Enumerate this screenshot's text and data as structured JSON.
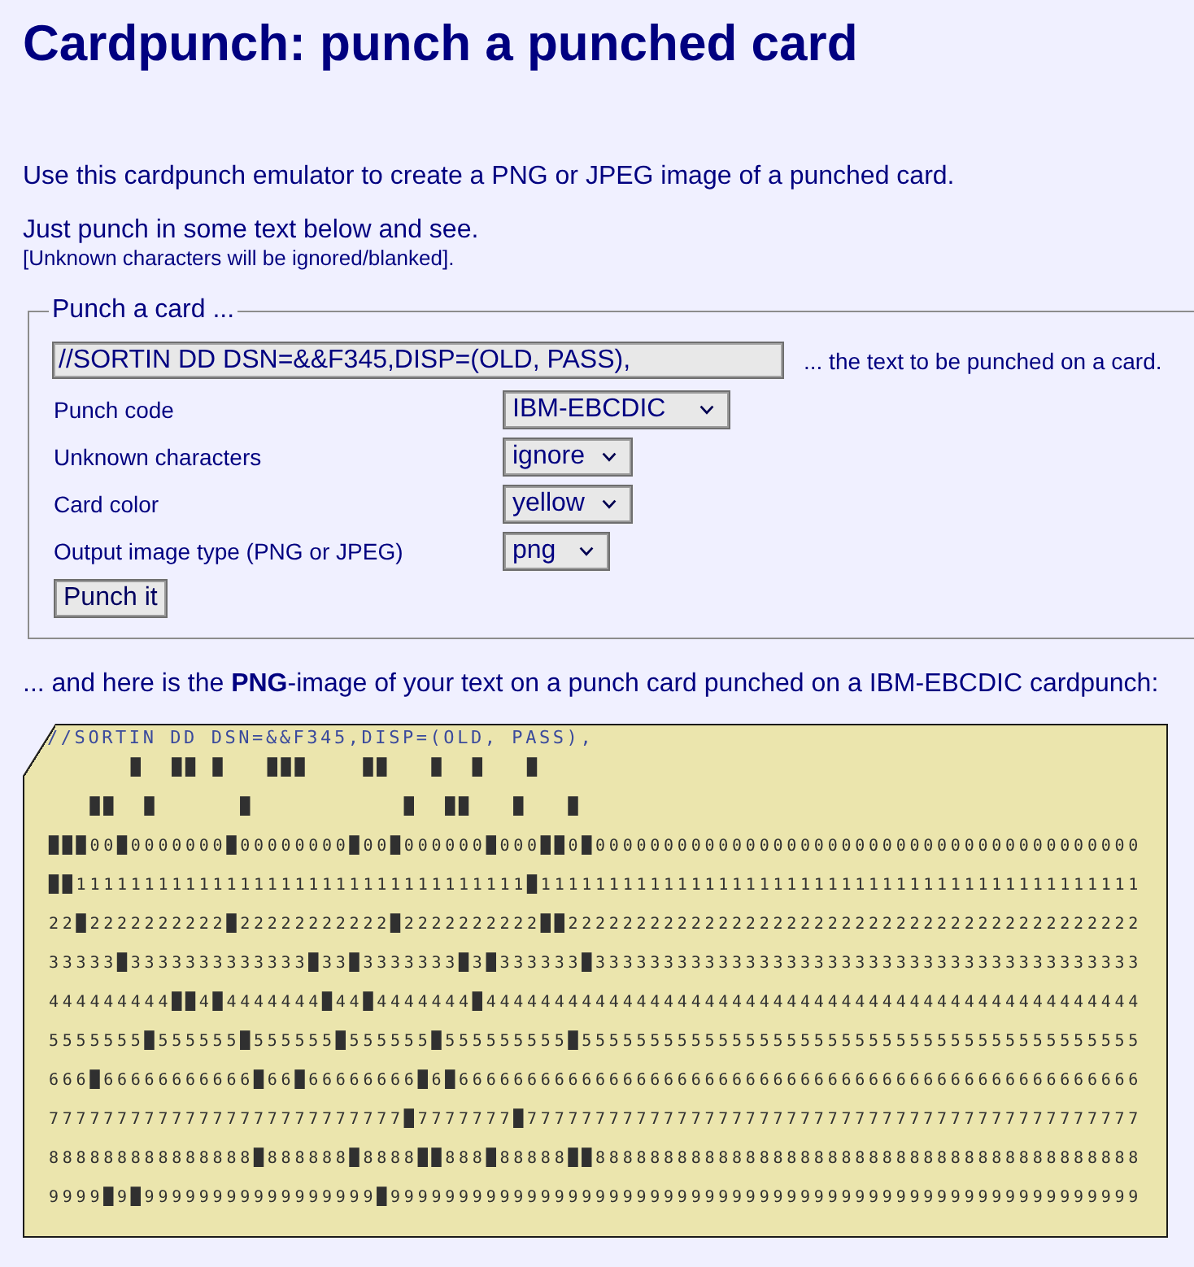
{
  "title": "Cardpunch: punch a punched card",
  "intro": [
    "Use this cardpunch emulator to create a PNG or JPEG image of a punched card.",
    "Just punch in some text below and see."
  ],
  "note": "[Unknown characters will be ignored/blanked].",
  "form": {
    "legend": "Punch a card ...",
    "text_field": {
      "value": "//SORTIN DD DSN=&&F345,DISP=(OLD, PASS),",
      "note": "... the text to be punched on a card."
    },
    "options": [
      {
        "label": "Punch code",
        "value": "IBM-EBCDIC"
      },
      {
        "label": "Unknown characters",
        "value": "ignore"
      },
      {
        "label": "Card color",
        "value": "yellow"
      },
      {
        "label": "Output image type (PNG or JPEG)",
        "value": "png"
      }
    ],
    "submit_button": "Punch it"
  },
  "result_caption": "... and here is the **PNG**-image of your text on a punch card punched on a IBM-EBCDIC cardpunch:",
  "card": {
    "printed_text": "//SORTIN DD DSN=&&F345,DISP=(OLD, PASS),",
    "rows": [
      "      █  ██ █   ███    ██   █  █   █",
      "   ██  █      █           █  ██   █   █",
      "███00█0000000█00000000█00█000000█000██0█0000000000000000000000000000000000000000",
      "██111111111111111111111111111111111█11111111111111111111111111111111111111111111",
      "22█2222222222█22222222222█2222222222██222222222222222222222222222222222222222222",
      "33333█3333333333333█33█3333333█3█333333█3333333333333333333333333333333333333333",
      "444444444██4█4444444█44█4444444█444444444444444444444444444444444444444444444444",
      "5555555█555555█555555█555555█555555555█55555555555555555555555555555555555555555",
      "666█66666666666█66█66666666█6█66666666666666666666666666666666666666666666666666",
      "77777777777777777777777777█7777777█777777777777777777777777777777777777777777777",
      "888888888888888█888888█8888██888█88888██8888888888888888888888888888888888888888",
      "9999█9█99999999999999999█9999999999999999999999999999999999999999999999999999999"
    ]
  }
}
